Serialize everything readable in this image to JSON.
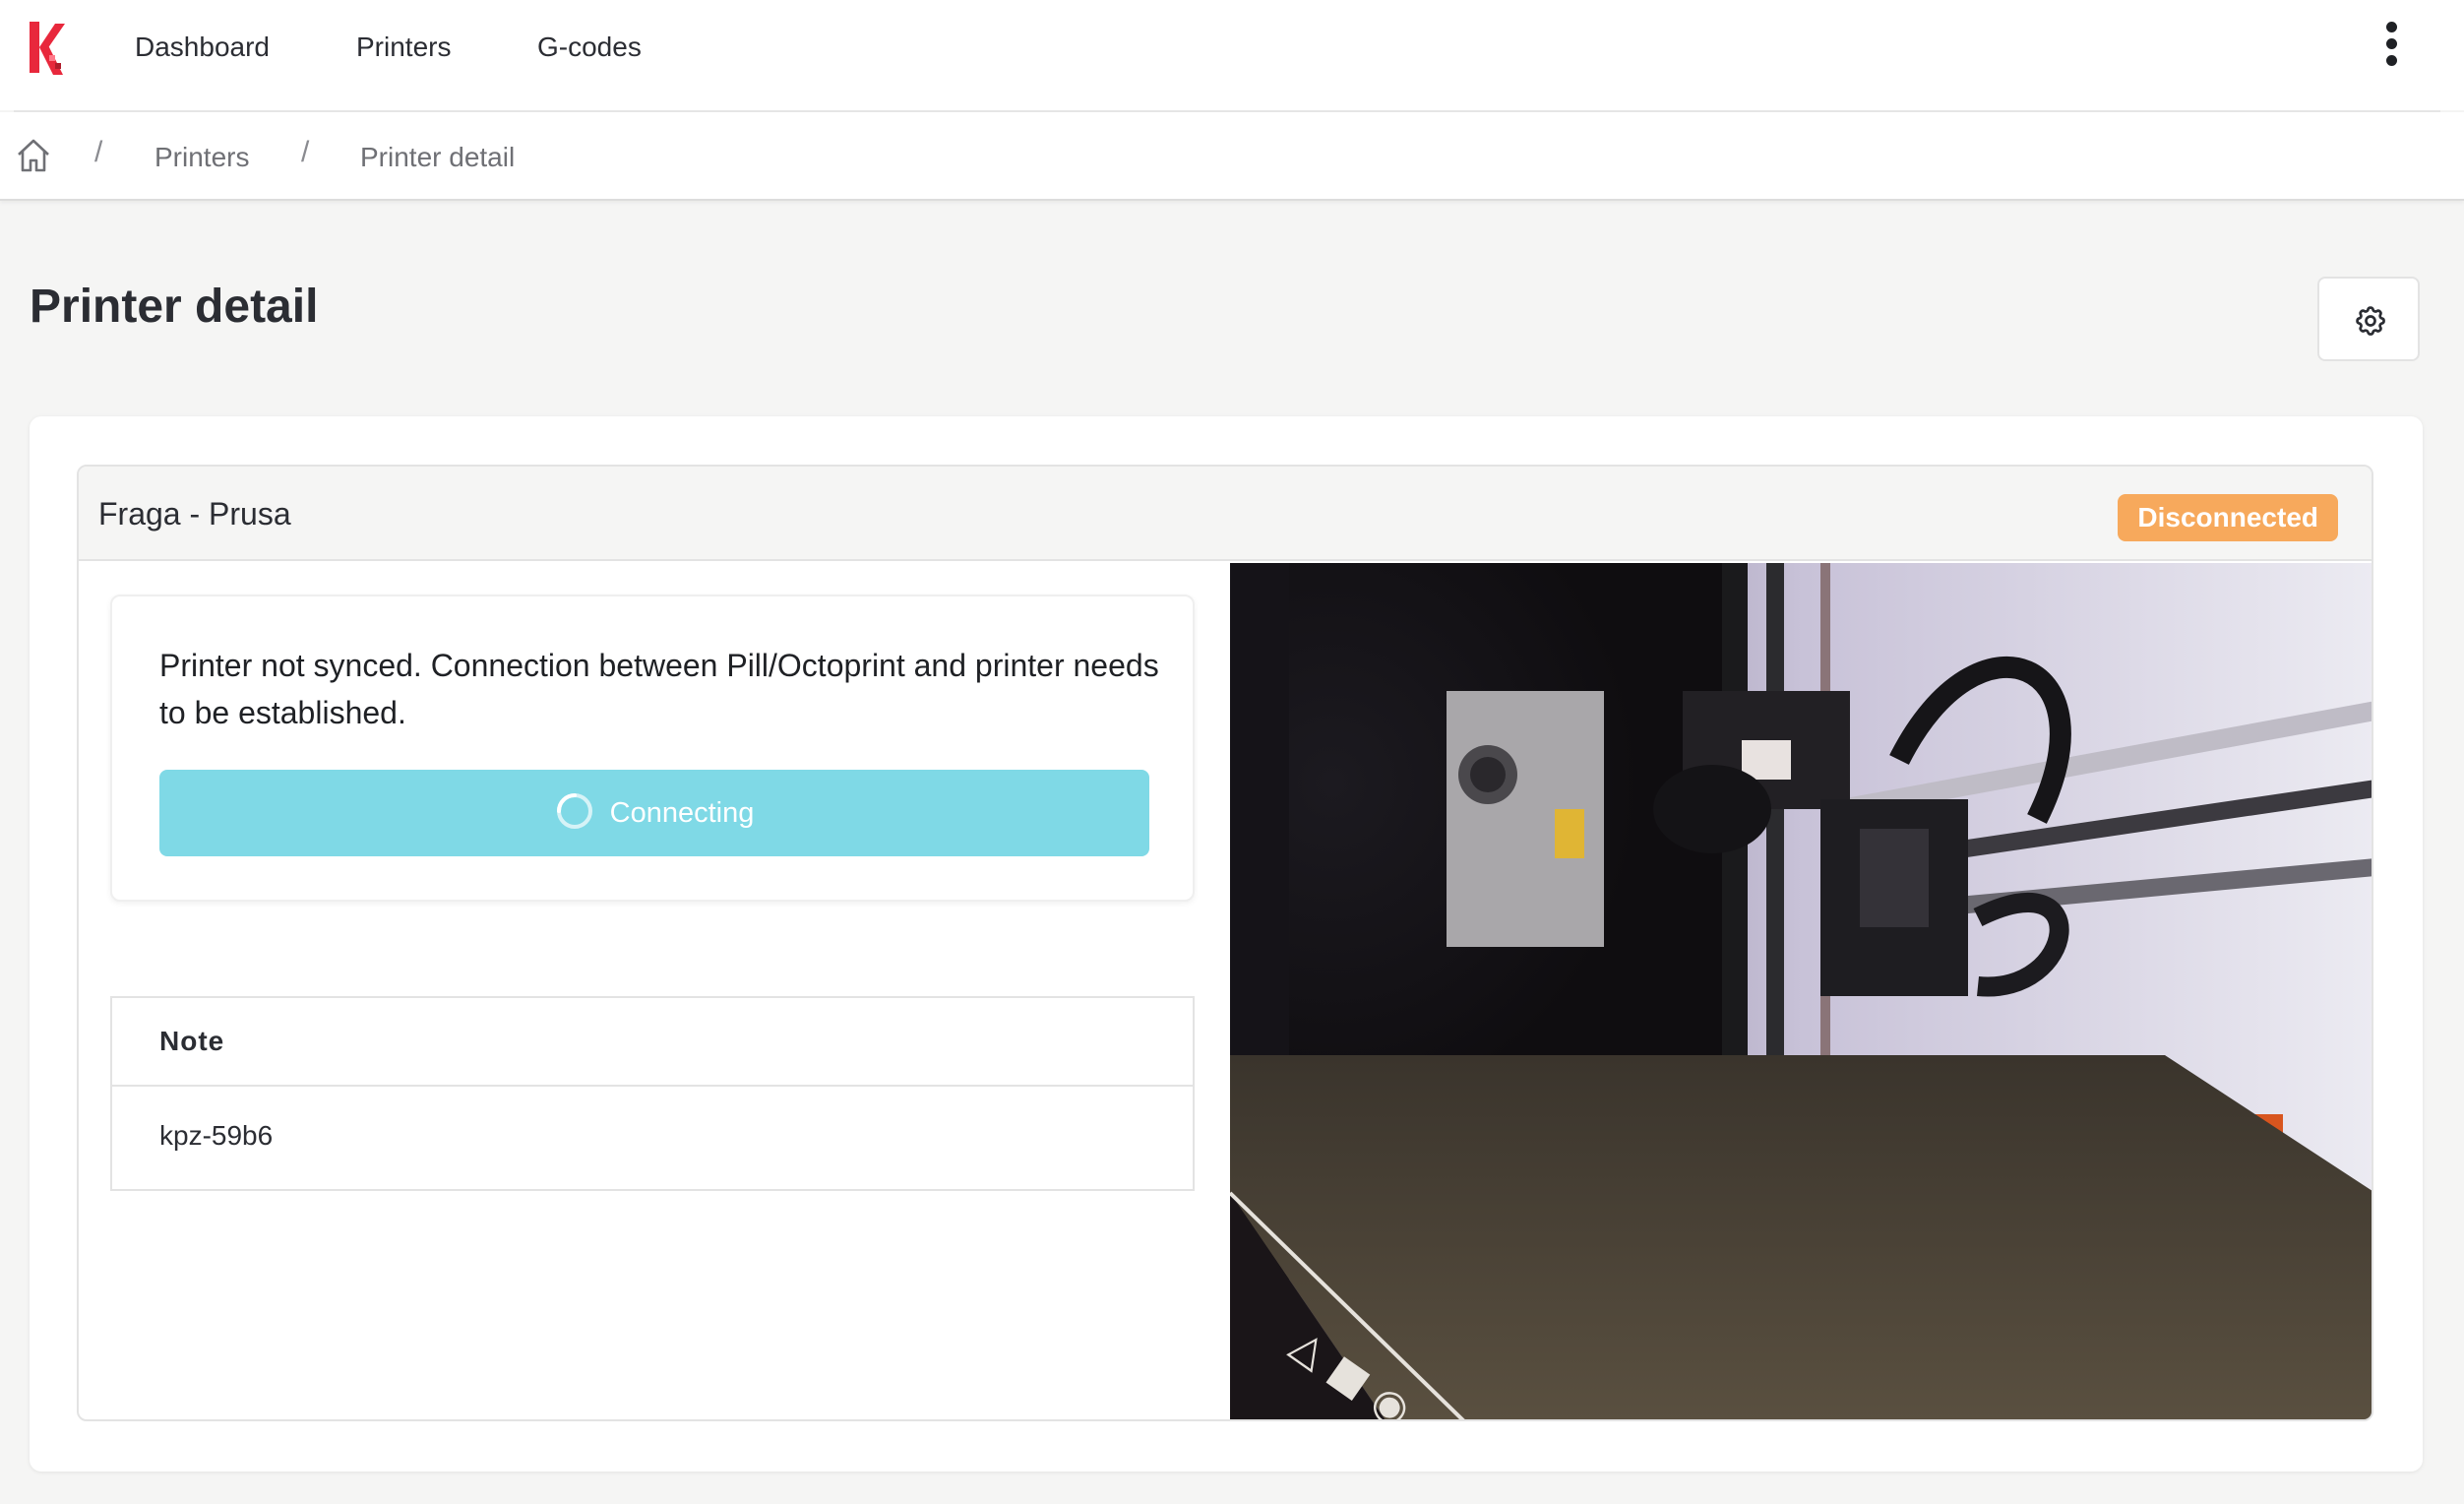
{
  "nav": {
    "items": [
      "Dashboard",
      "Printers",
      "G-codes"
    ]
  },
  "breadcrumb": {
    "separator": "/",
    "items": [
      "Printers",
      "Printer detail"
    ]
  },
  "page": {
    "title": "Printer detail"
  },
  "printer": {
    "name": "Fraga - Prusa",
    "status": "Disconnected",
    "status_color": "#f7a95c",
    "sync_message": "Printer not synced. Connection between Pill/Octoprint and printer needs to be established.",
    "connect_button_label": "Connecting",
    "connect_button_color": "#7fd9e6",
    "note": {
      "header": "Note",
      "value": "kpz-59b6"
    }
  },
  "icons": {
    "logo": "app-logo",
    "home": "home-icon",
    "settings": "gear-icon",
    "menu": "kebab-menu-icon",
    "spinner": "spinner-icon"
  }
}
